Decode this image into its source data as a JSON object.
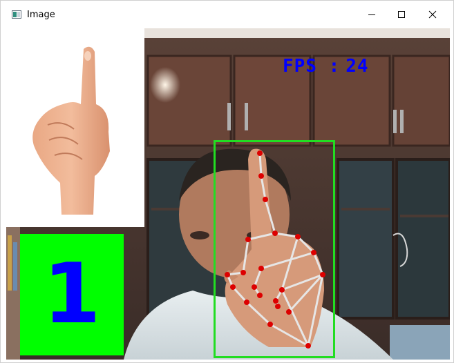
{
  "window": {
    "title": "Image",
    "icons": {
      "app": "app-window-icon",
      "minimize": "minimize-icon",
      "maximize": "maximize-icon",
      "close": "close-icon"
    }
  },
  "overlay": {
    "fps_label": "FPS :",
    "fps_value": "24",
    "finger_count": "1",
    "colors": {
      "fps_text": "#0000ff",
      "count_box": "#00ff00",
      "count_text": "#0000ff",
      "bounding_box": "#22dd22",
      "landmark": "#dd0000",
      "skeleton": "#e6e6e6"
    }
  },
  "hand_landmarks": 21
}
